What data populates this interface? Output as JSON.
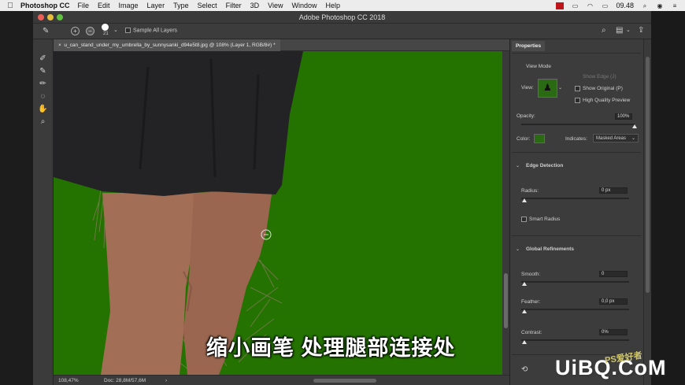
{
  "menubar": {
    "app_name": "Photoshop CC",
    "items": [
      "File",
      "Edit",
      "Image",
      "Layer",
      "Type",
      "Select",
      "Filter",
      "3D",
      "View",
      "Window",
      "Help"
    ],
    "time": "09.48"
  },
  "window": {
    "title": "Adobe Photoshop CC 2018"
  },
  "options_bar": {
    "brush_size": "21",
    "sample_all_layers": "Sample All Layers"
  },
  "document": {
    "tab_title": "u_can_stand_under_my_umbrella_by_sunnysanki_d94e5t8.jpg @ 108% (Layer 1, RGB/8#) *",
    "zoom": "108,47%",
    "doc_info": "Doc: 28,8M/57,6M"
  },
  "overlay": {
    "subtitle": "缩小画笔 处理腿部连接处",
    "watermark_main": "UiBQ.CoM",
    "watermark_script": "PS爱好者"
  },
  "properties": {
    "tab": "Properties",
    "view_mode_label": "View Mode",
    "view_label": "View:",
    "show_edge": "Show Edge (J)",
    "show_original": "Show Original (P)",
    "high_quality": "High Quality Preview",
    "opacity_label": "Opacity:",
    "opacity_value": "100%",
    "opacity_level": 1.0,
    "color_label": "Color:",
    "overlay_color": "#2a6a12",
    "indicates_label": "Indicates:",
    "indicates_value": "Masked Areas",
    "edge_detection": "Edge Detection",
    "radius_label": "Radius:",
    "radius_value": "0 px",
    "smart_radius": "Smart Radius",
    "global_refinements": "Global Refinements",
    "smooth_label": "Smooth:",
    "smooth_value": "0",
    "feather_label": "Feather:",
    "feather_value": "0,0 px",
    "contrast_label": "Contrast:",
    "contrast_value": "0%"
  },
  "colors": {
    "canvas_green": "#247200",
    "skirt": "#232325",
    "skin": "#a26e55"
  }
}
